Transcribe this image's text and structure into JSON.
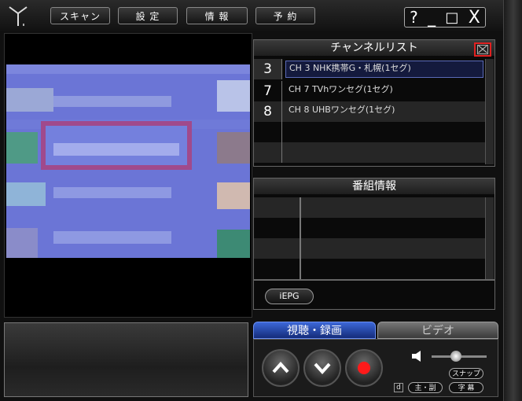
{
  "menu": {
    "scan_label": "スキャン",
    "settings_label": "設 定",
    "info_label": "情 報",
    "reserve_label": "予 約"
  },
  "window_controls": {
    "help": "?",
    "minimize": "_",
    "maximize": "□",
    "close": "X"
  },
  "channel_list": {
    "title": "チャンネルリスト",
    "items": [
      {
        "number": "3",
        "name": "CH 3 NHK携帯G・札幌(1セグ)",
        "selected": true
      },
      {
        "number": "7",
        "name": "CH 7 TVhワンセグ(1セグ)",
        "selected": false
      },
      {
        "number": "8",
        "name": "CH 8 UHBワンセグ(1セグ)",
        "selected": false
      }
    ]
  },
  "program_info": {
    "title": "番組情報",
    "iepg_label": "iEPG"
  },
  "tabs": {
    "active": "視聴・録画",
    "inactive": "ビデオ"
  },
  "remote": {
    "snap_label": "スナップ",
    "audio_label": "主・副",
    "subtitle_label": "字 幕",
    "d_label": "d"
  },
  "colors": {
    "accent_blue": "#2b50c8",
    "record_red": "#ff1a1a",
    "close_highlight": "#e02020"
  }
}
